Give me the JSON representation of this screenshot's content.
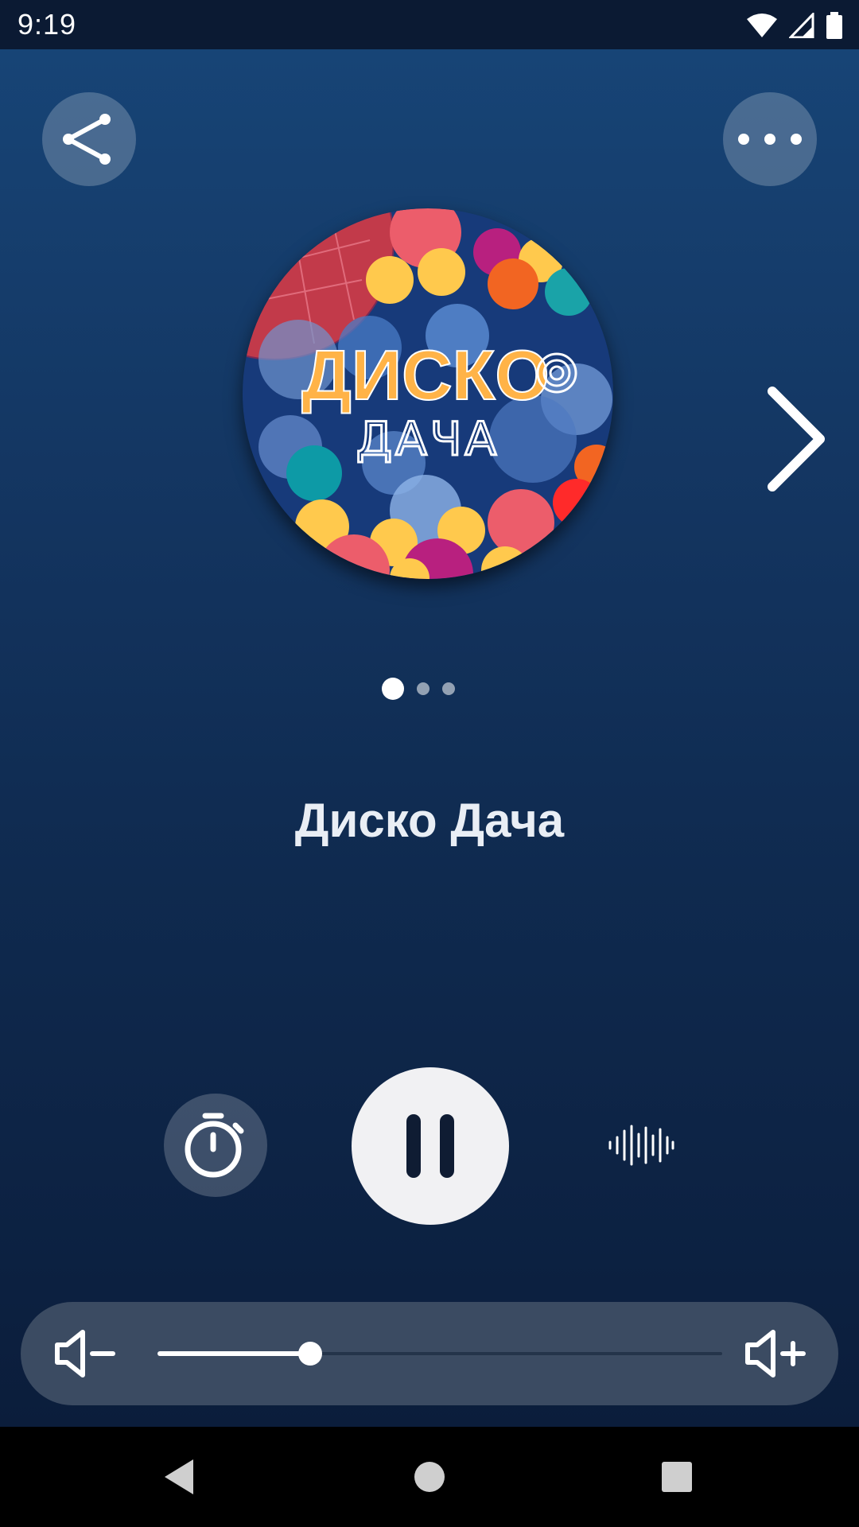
{
  "status_bar": {
    "time": "9:19",
    "icons": [
      "wifi-icon",
      "signal-icon",
      "battery-icon"
    ]
  },
  "top_bar": {
    "share_icon": "share-icon",
    "more_icon": "more-horizontal-icon"
  },
  "station": {
    "title": "Диско Дача",
    "logo_text_line1": "ДИСКО",
    "logo_text_line2": "ДАЧА"
  },
  "carousel": {
    "page_count": 3,
    "active_index": 0,
    "next_icon": "chevron-right-icon"
  },
  "controls": {
    "timer_icon": "stopwatch-icon",
    "play_pause_icon": "pause-icon",
    "equalizer_icon": "audio-wave-icon"
  },
  "volume": {
    "level": 0.27,
    "down_icon": "volume-down-icon",
    "up_icon": "volume-up-icon"
  },
  "nav_bar": {
    "buttons": [
      "back-icon",
      "home-icon",
      "recents-icon"
    ]
  },
  "colors": {
    "background_top": "#174476",
    "background_bottom": "#0b1d3b",
    "volume_bar": "#3b4b62",
    "play_button": "#f1f1f3"
  }
}
